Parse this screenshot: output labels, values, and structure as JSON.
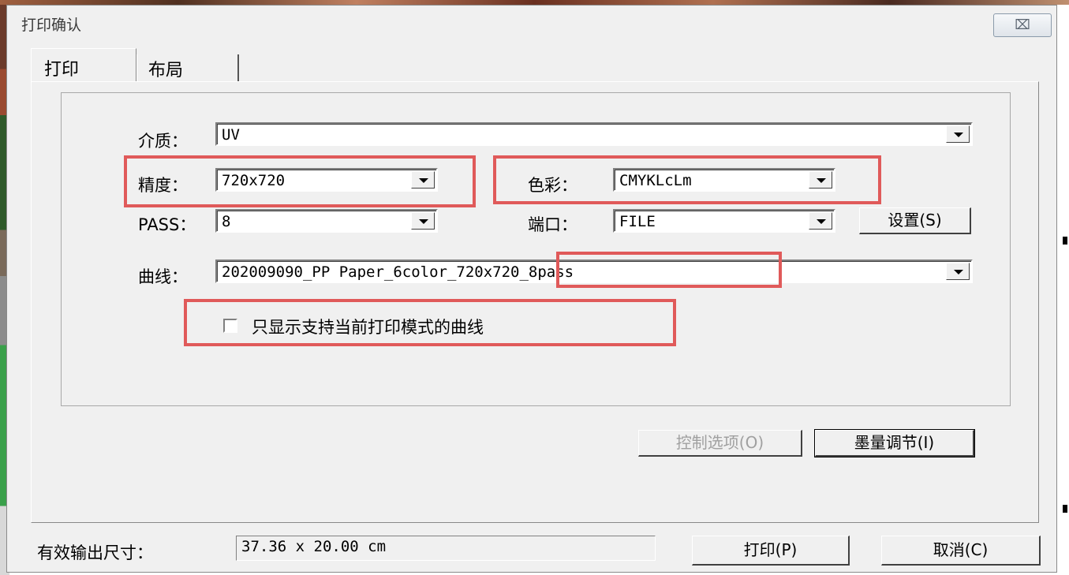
{
  "window": {
    "title": "打印确认",
    "close_label": "⌧"
  },
  "tabs": [
    {
      "label": "打印"
    },
    {
      "label": "布局"
    }
  ],
  "form": {
    "media": {
      "label": "介质：",
      "value": "UV"
    },
    "resolution": {
      "label": "精度：",
      "value": "720x720"
    },
    "color": {
      "label": "色彩：",
      "value": "CMYKLcLm"
    },
    "pass": {
      "label": "PASS：",
      "value": "8"
    },
    "port": {
      "label": "端口：",
      "value": "FILE"
    },
    "settings_button": "设置(S)",
    "curve": {
      "label": "曲线：",
      "value": "202009090_PP Paper_6color_720x720_8pass"
    },
    "filter_checkbox": {
      "label": "只显示支持当前打印模式的曲线",
      "checked": false
    }
  },
  "buttons": {
    "control_options": "控制选项(O)",
    "ink_adjust": "墨量调节(I)",
    "print": "打印(P)",
    "cancel": "取消(C)"
  },
  "output": {
    "label": "有效输出尺寸：",
    "value": "37.36 x 20.00 cm"
  },
  "colors": {
    "highlight": "#e05a5a",
    "dialog_bg": "#f0f0f0"
  }
}
